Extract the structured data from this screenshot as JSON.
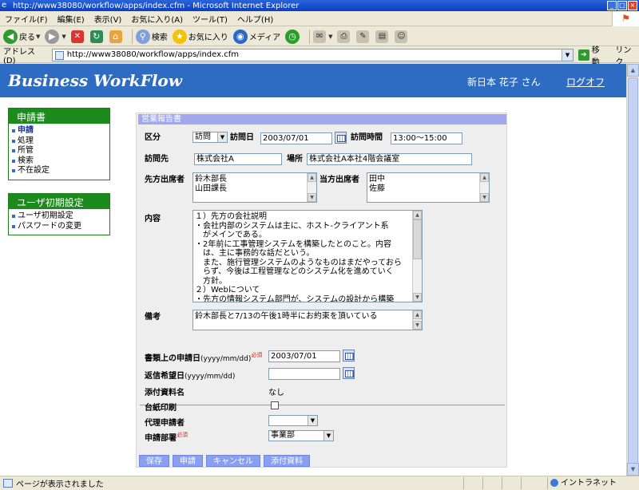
{
  "window": {
    "title": "http://www38080/workflow/apps/index.cfm - Microsoft Internet Explorer",
    "minimize": "_",
    "maximize": "□",
    "close": "×"
  },
  "menubar": [
    "ファイル(F)",
    "編集(E)",
    "表示(V)",
    "お気に入り(A)",
    "ツール(T)",
    "ヘルプ(H)"
  ],
  "toolbar": {
    "back": "戻る",
    "search": "検索",
    "favorites": "お気に入り",
    "media": "メディア"
  },
  "addressbar": {
    "label": "アドレス(D)",
    "url": "http://www38080/workflow/apps/index.cfm",
    "go": "移動",
    "links": "リンク"
  },
  "header": {
    "logo": "Business WorkFlow",
    "user": "新日本 花子 さん",
    "logout": "ログオフ"
  },
  "nav": [
    {
      "title": "申請書",
      "items": [
        {
          "label": "申請",
          "active": true
        },
        {
          "label": "処理",
          "active": false
        },
        {
          "label": "所管",
          "active": false
        },
        {
          "label": "検索",
          "active": false
        },
        {
          "label": "不在設定",
          "active": false
        }
      ]
    },
    {
      "title": "ユーザ初期設定",
      "items": [
        {
          "label": "ユーザ初期設定",
          "active": false
        },
        {
          "label": "パスワードの変更",
          "active": false
        }
      ]
    }
  ],
  "form": {
    "title": "営業報告書",
    "kubun": {
      "label": "区分",
      "value": "訪問"
    },
    "visit_date": {
      "label": "訪問日",
      "value": "2003/07/01"
    },
    "visit_time": {
      "label": "訪問時間",
      "value": "13:00～15:00"
    },
    "visit_to": {
      "label": "訪問先",
      "value": "株式会社A"
    },
    "place": {
      "label": "場所",
      "value": "株式会社A本社4階会議室"
    },
    "their_attendees": {
      "label": "先方出席者",
      "lines": [
        "鈴木部長",
        "山田課長"
      ]
    },
    "our_attendees": {
      "label": "当方出席者",
      "lines": [
        "田中",
        "佐藤"
      ]
    },
    "content": {
      "label": "内容",
      "lines": [
        "１）先方の会社説明",
        "・会社内部のシステムは主に、ホスト-クライアント系",
        "　がメインである。",
        "・2年前に工事管理システムを構築したとのこと。内容",
        "　は、主に事務的な話だという。",
        "　また、施行管理システムのようなものはまだやっておら",
        "　らず、今後は工程管理などのシステム化を進めていく",
        "　方針。",
        "２）Webについて",
        "・先方の情報システム部門が、システムの設計から構築"
      ]
    },
    "remarks": {
      "label": "備考",
      "value": "鈴木部長と7/13の午後1時半にお約束を頂いている"
    },
    "doc_date": {
      "label": "書類上の申請日",
      "hint": "(yyyy/mm/dd)",
      "required": "必須",
      "value": "2003/07/01"
    },
    "reply_date": {
      "label": "返信希望日",
      "hint": "(yyyy/mm/dd)",
      "value": ""
    },
    "attachment": {
      "label": "添付資料名",
      "value": "なし"
    },
    "ledger_print": {
      "label": "台紙印刷"
    },
    "proxy": {
      "label": "代理申請者",
      "value": ""
    },
    "dept": {
      "label": "申請部署",
      "required": "必須",
      "value": "事業部"
    }
  },
  "buttons": {
    "save": "保存",
    "apply": "申請",
    "cancel": "キャンセル",
    "attach": "添付資料"
  },
  "status": {
    "text": "ページが表示されました",
    "zone": "イントラネット"
  }
}
